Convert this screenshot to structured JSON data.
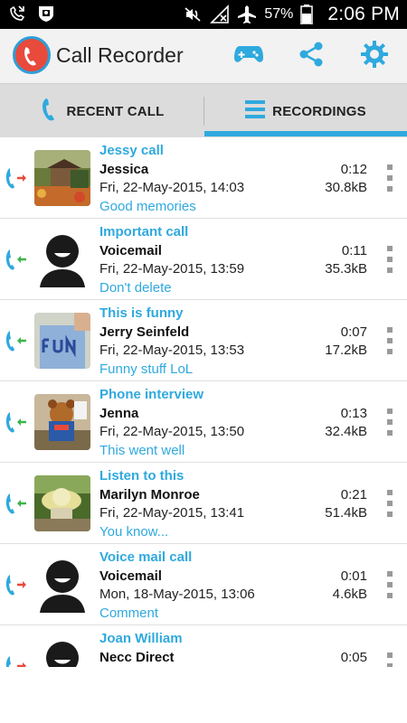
{
  "status_bar": {
    "battery_percent": "57%",
    "time": "2:06 PM",
    "icons": [
      "missed-call-icon",
      "shield-icon",
      "mute-icon",
      "no-signal-icon",
      "airplane-icon",
      "battery-icon"
    ]
  },
  "action_bar": {
    "title": "Call Recorder",
    "icons": [
      "app-logo-icon",
      "gamepad-icon",
      "share-icon",
      "settings-icon"
    ],
    "accent": "#2fa9de"
  },
  "tabs": [
    {
      "label": "RECENT CALL",
      "icon": "phone-icon",
      "selected": false
    },
    {
      "label": "RECORDINGS",
      "icon": "list-icon",
      "selected": true
    }
  ],
  "recordings": [
    {
      "title": "Jessy call",
      "name": "Jessica",
      "date": "Fri, 22-May-2015, 14:03",
      "note": "Good memories",
      "duration": "0:12",
      "size": "30.8kB",
      "direction": "outgoing",
      "thumb": "photo-garden"
    },
    {
      "title": "Important call",
      "name": "Voicemail",
      "date": "Fri, 22-May-2015, 13:59",
      "note": "Don't delete",
      "duration": "0:11",
      "size": "35.3kB",
      "direction": "incoming",
      "thumb": "generic-avatar"
    },
    {
      "title": "This is funny",
      "name": "Jerry Seinfeld",
      "date": "Fri, 22-May-2015, 13:53",
      "note": "Funny stuff LoL",
      "duration": "0:07",
      "size": "17.2kB",
      "direction": "incoming",
      "thumb": "photo-fun-shirt"
    },
    {
      "title": "Phone interview",
      "name": "Jenna",
      "date": "Fri, 22-May-2015, 13:50",
      "note": "This went well",
      "duration": "0:13",
      "size": "32.4kB",
      "direction": "incoming",
      "thumb": "photo-teddy-bear"
    },
    {
      "title": "Listen to this",
      "name": "Marilyn Monroe",
      "date": "Fri, 22-May-2015, 13:41",
      "note": "You know...",
      "duration": "0:21",
      "size": "51.4kB",
      "direction": "incoming",
      "thumb": "photo-sun-hat"
    },
    {
      "title": "Voice mail call",
      "name": "Voicemail",
      "date": "Mon, 18-May-2015, 13:06",
      "note": "Comment",
      "duration": "0:01",
      "size": "4.6kB",
      "direction": "outgoing",
      "thumb": "generic-avatar"
    },
    {
      "title": "Joan William",
      "name": "Necc Direct",
      "date": "",
      "note": "",
      "duration": "0:05",
      "size": "",
      "direction": "outgoing",
      "thumb": "generic-avatar"
    }
  ]
}
